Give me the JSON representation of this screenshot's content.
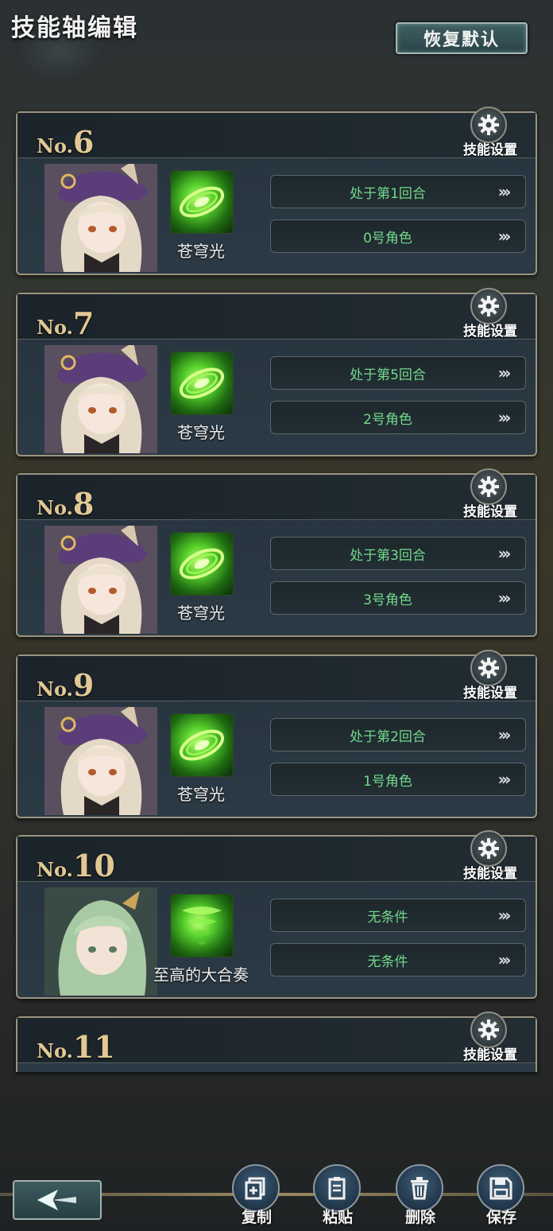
{
  "header": {
    "title": "技能轴编辑",
    "reset_label": "恢复默认"
  },
  "settings_label": "技能设置",
  "entries": [
    {
      "no_prefix": "No.",
      "number": "6",
      "skill_name": "苍穹光",
      "cond1": "处于第1回合",
      "cond2": "0号角色",
      "arrows": "›››",
      "portrait": "bunny-hat-girl",
      "skill_icon": "green-vortex"
    },
    {
      "no_prefix": "No.",
      "number": "7",
      "skill_name": "苍穹光",
      "cond1": "处于第5回合",
      "cond2": "2号角色",
      "arrows": "›››",
      "portrait": "bunny-hat-girl",
      "skill_icon": "green-vortex"
    },
    {
      "no_prefix": "No.",
      "number": "8",
      "skill_name": "苍穹光",
      "cond1": "处于第3回合",
      "cond2": "3号角色",
      "arrows": "›››",
      "portrait": "bunny-hat-girl",
      "skill_icon": "green-vortex"
    },
    {
      "no_prefix": "No.",
      "number": "9",
      "skill_name": "苍穹光",
      "cond1": "处于第2回合",
      "cond2": "1号角色",
      "arrows": "›››",
      "portrait": "bunny-hat-girl",
      "skill_icon": "green-vortex"
    },
    {
      "no_prefix": "No.",
      "number": "10",
      "skill_name": "至高的大合奏",
      "cond1": "无条件",
      "cond2": "无条件",
      "arrows": "›››",
      "portrait": "green-hair-girl",
      "skill_icon": "green-tornado"
    },
    {
      "no_prefix": "No.",
      "number": "11"
    }
  ],
  "bottom": {
    "back_icon": "back-arrow-icon",
    "copy_label": "复制",
    "paste_label": "粘贴",
    "delete_label": "删除",
    "save_label": "保存"
  },
  "colors": {
    "condition_text": "#72d98a",
    "number_gold": "#e2c894",
    "frame": "#9b9480"
  }
}
